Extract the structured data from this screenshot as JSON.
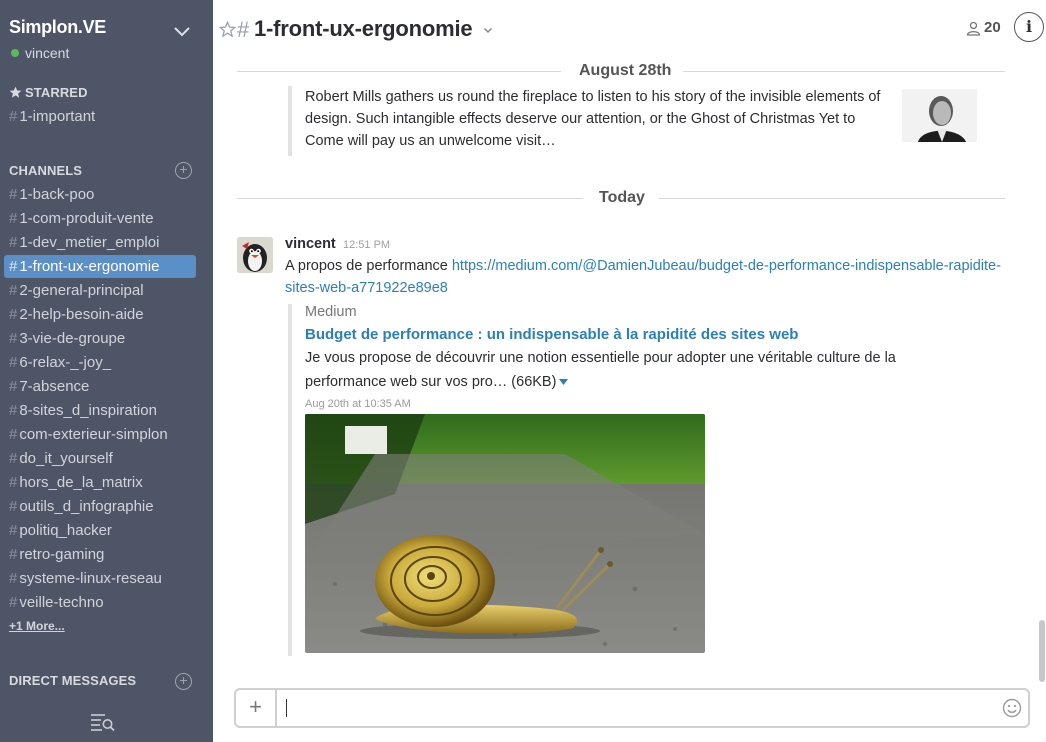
{
  "team": {
    "name": "Simplon.VE",
    "user": "vincent"
  },
  "sidebar": {
    "starred_title": "STARRED",
    "starred": [
      {
        "label": "1-important"
      }
    ],
    "channels_title": "CHANNELS",
    "channels": [
      {
        "label": "1-back-poo"
      },
      {
        "label": "1-com-produit-vente"
      },
      {
        "label": "1-dev_metier_emploi"
      },
      {
        "label": "1-front-ux-ergonomie",
        "active": true
      },
      {
        "label": "2-general-principal"
      },
      {
        "label": "2-help-besoin-aide"
      },
      {
        "label": "3-vie-de-groupe"
      },
      {
        "label": "6-relax-_-joy_"
      },
      {
        "label": "7-absence"
      },
      {
        "label": "8-sites_d_inspiration"
      },
      {
        "label": "com-exterieur-simplon"
      },
      {
        "label": "do_it_yourself"
      },
      {
        "label": "hors_de_la_matrix"
      },
      {
        "label": "outils_d_infographie"
      },
      {
        "label": "politiq_hacker"
      },
      {
        "label": "retro-gaming"
      },
      {
        "label": "systeme-linux-reseau"
      },
      {
        "label": "veille-techno"
      }
    ],
    "more": "+1 More...",
    "dm_title": "DIRECT MESSAGES",
    "hash": "#"
  },
  "header": {
    "hash": "#",
    "channel_name": "1-front-ux-ergonomie",
    "member_count": "20",
    "info": "i"
  },
  "messages": {
    "divider_1": "August 28th",
    "quote_text": "Robert Mills gathers us round the fireplace to listen to his story of the invisible elements of design. Such intangible effects deserve our attention, or the Ghost of Christmas Yet to Come will pay us an unwelcome visit…",
    "divider_2": "Today",
    "author": "vincent",
    "time": "12:51 PM",
    "text_prefix": "A propos de performance ",
    "link": "https://medium.com/@DamienJubeau/budget-de-performance-indispensable-rapidite-sites-web-a771922e89e8",
    "attachment": {
      "service": "Medium",
      "title": "Budget de performance : un indispensable à la rapidité des sites web",
      "description": "Je vous propose de découvrir une notion essentielle pour adopter une véritable culture de la performance web sur vos pro… (66KB)",
      "date": "Aug 20th at 10:35 AM"
    }
  },
  "composer": {
    "plus": "+",
    "placeholder": ""
  },
  "colors": {
    "sidebar_bg": "#4d5567",
    "active_channel": "#5b8fc7",
    "link": "#2a80b9",
    "presence": "#5cb85c"
  }
}
